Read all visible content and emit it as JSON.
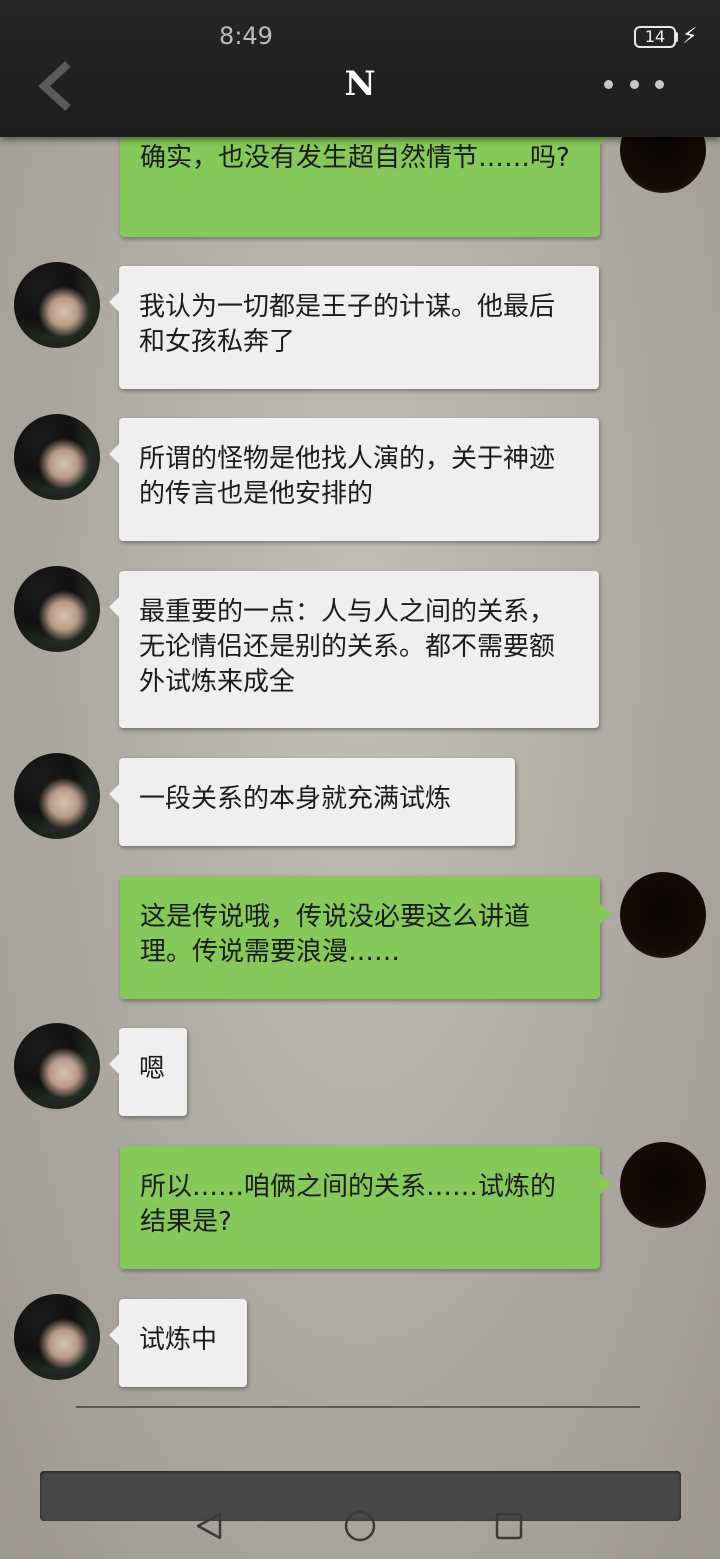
{
  "status_bar": {
    "time": "8:49",
    "battery": "14"
  },
  "header": {
    "title": "N"
  },
  "messages": [
    {
      "side": "sent",
      "text": "确实，也没有发生超自然情节……吗?"
    },
    {
      "side": "recv",
      "text": "我认为一切都是王子的计谋。他最后和女孩私奔了"
    },
    {
      "side": "recv",
      "text": "所谓的怪物是他找人演的，关于神迹的传言也是他安排的"
    },
    {
      "side": "recv",
      "text": "最重要的一点：人与人之间的关系，无论情侣还是别的关系。都不需要额外试炼来成全"
    },
    {
      "side": "recv",
      "text": "一段关系的本身就充满试炼"
    },
    {
      "side": "sent",
      "text": "这是传说哦，传说没必要这么讲道理。传说需要浪漫……"
    },
    {
      "side": "recv",
      "text": "嗯"
    },
    {
      "side": "sent",
      "text": "所以……咱俩之间的关系……试炼的结果是?"
    },
    {
      "side": "recv",
      "text": "试炼中"
    }
  ],
  "icons": {
    "back": "chevron-left-icon",
    "more": "more-dots-icon",
    "nav_back": "triangle-back-icon",
    "nav_home": "circle-home-icon",
    "nav_recent": "square-recent-icon"
  },
  "colors": {
    "sent_bubble": "#86c85a",
    "recv_bubble": "#efefef",
    "topbar": "#222222"
  }
}
